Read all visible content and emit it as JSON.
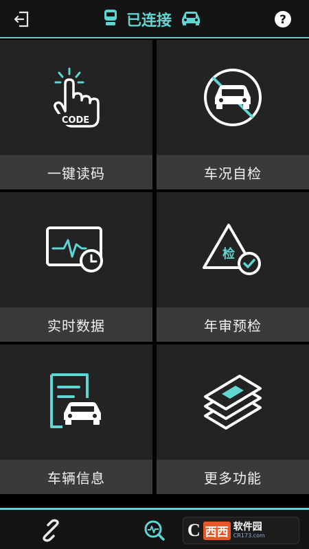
{
  "header": {
    "status_text": "已连接",
    "accent": "#5fd6d1",
    "icons": [
      "exit-icon",
      "connector-icon",
      "car-icon",
      "help-icon"
    ]
  },
  "tiles": [
    {
      "label": "一键读码",
      "icon": "touch-code-icon"
    },
    {
      "label": "车况自检",
      "icon": "car-inspect-icon"
    },
    {
      "label": "实时数据",
      "icon": "monitor-clock-icon"
    },
    {
      "label": "年审预检",
      "icon": "inspection-triangle-icon",
      "icon_text": "检"
    },
    {
      "label": "车辆信息",
      "icon": "vehicle-document-icon"
    },
    {
      "label": "更多功能",
      "icon": "layers-icon"
    }
  ],
  "footer": {
    "icons": [
      "link-icon",
      "diagnose-search-icon"
    ]
  },
  "watermark": {
    "letter": "C",
    "brand_chars": "西西",
    "brand_name": "软件园",
    "url": "CR173.com"
  }
}
